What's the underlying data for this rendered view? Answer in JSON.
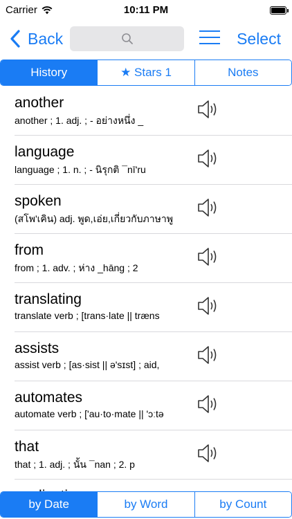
{
  "status_bar": {
    "carrier": "Carrier",
    "time": "10:11 PM"
  },
  "nav": {
    "back_label": "Back",
    "search_placeholder": "",
    "select_label": "Select",
    "accent_color": "#1a7cf4"
  },
  "top_tabs": [
    {
      "label": "History",
      "active": true
    },
    {
      "label": "★ Stars 1",
      "active": false
    },
    {
      "label": "Notes",
      "active": false
    }
  ],
  "entries": [
    {
      "word": "another",
      "definition": "another ;  1.   adj. ;   -  อย่างหนึ่ง   _"
    },
    {
      "word": "language",
      "definition": "language ;  1.   n. ;   -  นิรุกติ   ¯nī'ru"
    },
    {
      "word": "spoken",
      "definition": "(สโพ'เคิน) adj. พูด,เอ่ย,เกี่ยวกับภาษาพู"
    },
    {
      "word": "from",
      "definition": "from ;  1.   adv. ;     ห่าง   _hāng ;  2"
    },
    {
      "word": "translating",
      "definition": "translate verb ; [trans·late || træns"
    },
    {
      "word": "assists",
      "definition": "assist verb ; [as·sist || ə'sɪst] ; aid,"
    },
    {
      "word": "automates",
      "definition": "automate verb ; ['au·to·mate || 'ɔːtə"
    },
    {
      "word": "that",
      "definition": "that ;  1.   adj. ;     นั้น   ¯nan ;  2.   p"
    },
    {
      "word": "applications",
      "definition": ""
    }
  ],
  "bottom_tabs": [
    {
      "label": "by Date",
      "active": true
    },
    {
      "label": "by Word",
      "active": false
    },
    {
      "label": "by Count",
      "active": false
    }
  ]
}
